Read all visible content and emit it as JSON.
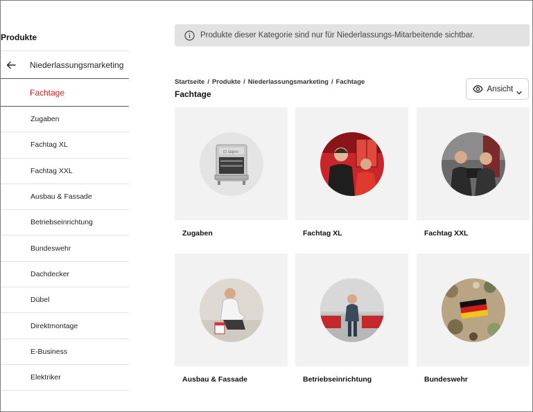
{
  "sidebar": {
    "title": "Produkte",
    "parent_label": "Niederlassungsmarketing",
    "active_label": "Fachtage",
    "items": [
      {
        "label": "Zugaben"
      },
      {
        "label": "Fachtag XL"
      },
      {
        "label": "Fachtag XXL"
      },
      {
        "label": "Ausbau & Fassade"
      },
      {
        "label": "Betriebseinrichtung"
      },
      {
        "label": "Bundeswehr"
      },
      {
        "label": "Dachdecker"
      },
      {
        "label": "Dübel"
      },
      {
        "label": "Direktmontage"
      },
      {
        "label": "E-Business"
      },
      {
        "label": "Elektriker"
      }
    ]
  },
  "notice": {
    "text": "Produkte dieser Kategorie sind nur für Niederlassungs-Mitarbeitende sichtbar.",
    "icon": "info-icon"
  },
  "breadcrumb": [
    "Startseite",
    "Produkte",
    "Niederlassungsmarketing",
    "Fachtage"
  ],
  "page_title": "Fachtage",
  "view_button": {
    "label": "Ansicht",
    "icon": "eye-icon"
  },
  "cards": [
    {
      "label": "Zugaben",
      "image": "grill"
    },
    {
      "label": "Fachtag XL",
      "image": "two-people-red"
    },
    {
      "label": "Fachtag XXL",
      "image": "two-people-workshop"
    },
    {
      "label": "Ausbau & Fassade",
      "image": "worker-kneeling"
    },
    {
      "label": "Betriebseinrichtung",
      "image": "person-workbench"
    },
    {
      "label": "Bundeswehr",
      "image": "camouflage-flag"
    }
  ],
  "colors": {
    "accent": "#d41d1d",
    "notice_bg": "#e2e2e2",
    "card_bg": "#f2f2f2"
  }
}
